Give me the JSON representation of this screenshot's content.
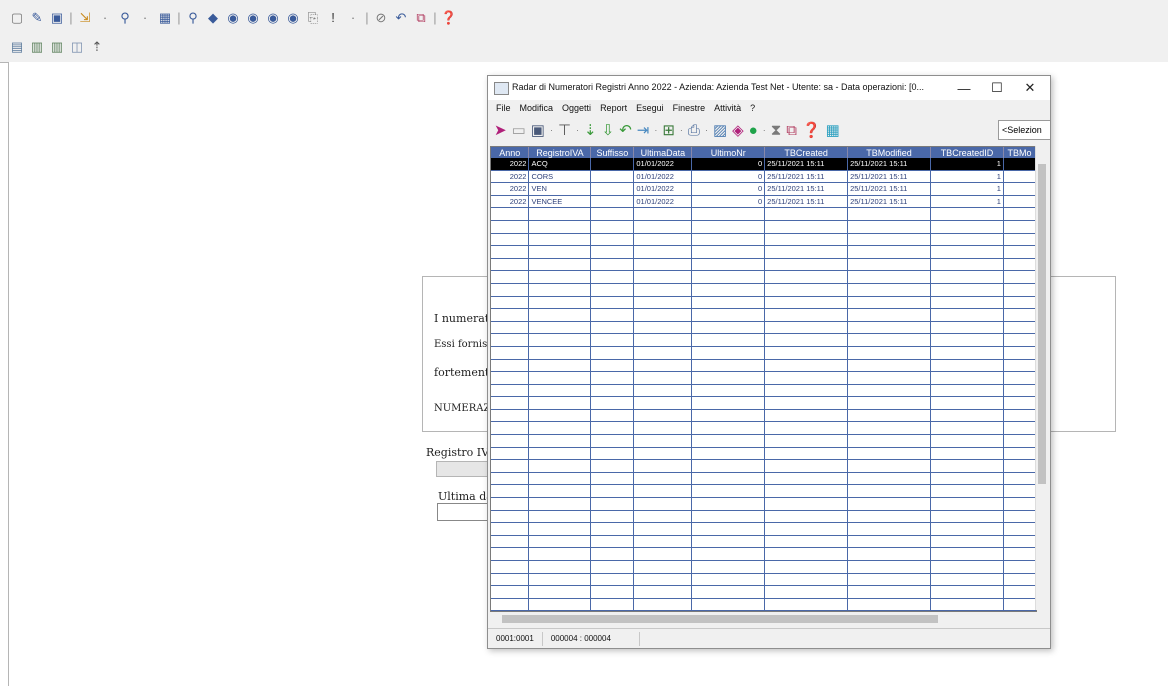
{
  "main_toolbar": {
    "row1_icons": [
      "new-document-icon",
      "edit-document-icon",
      "save-icon",
      "sep",
      "import-icon",
      "dropdown-icon",
      "search-tool-icon",
      "dropdown-icon",
      "settings-report-icon",
      "sep",
      "find-icon",
      "filter-icon",
      "first-record-icon",
      "prev-record-icon",
      "next-record-icon",
      "last-record-icon",
      "copy-icon",
      "exclamation-icon",
      "dropdown-icon",
      "sep",
      "attach-icon",
      "undo-icon",
      "gift-icon",
      "sep",
      "help-icon"
    ],
    "row2_icons": [
      "calendar-icon",
      "bank-icon",
      "bank-icon",
      "note-icon",
      "upload-icon"
    ]
  },
  "background_form": {
    "info_lines": [
      "I numerato",
      "Essi fornisc",
      "fortemente",
      "NUMERAZIO"
    ],
    "registro_label": "Registro IV",
    "ultima_label": "Ultima dat"
  },
  "dialog": {
    "title": "Radar di Numeratori Registri Anno 2022 - Azienda: Azienda Test Net - Utente: sa - Data operazioni: [0...",
    "window_controls": {
      "minimize": "—",
      "maximize": "☐",
      "close": "✕"
    },
    "menu": [
      "File",
      "Modifica",
      "Oggetti",
      "Report",
      "Esegui",
      "Finestre",
      "Attività",
      "?"
    ],
    "selector_text": "<Selezion",
    "grid": {
      "columns": [
        "Anno",
        "RegistroIVA",
        "Suffisso",
        "UltimaData",
        "UltimoNr",
        "TBCreated",
        "TBModified",
        "TBCreatedID",
        "TBMo"
      ],
      "rows": [
        [
          "2022",
          "ACQ",
          "",
          "01/01/2022",
          "0",
          "25/11/2021 15:11",
          "25/11/2021 15:11",
          "1",
          ""
        ],
        [
          "2022",
          "CORS",
          "",
          "01/01/2022",
          "0",
          "25/11/2021 15:11",
          "25/11/2021 15:11",
          "1",
          ""
        ],
        [
          "2022",
          "VEN",
          "",
          "01/01/2022",
          "0",
          "25/11/2021 15:11",
          "25/11/2021 15:11",
          "1",
          ""
        ],
        [
          "2022",
          "VENCEE",
          "",
          "01/01/2022",
          "0",
          "25/11/2021 15:11",
          "25/11/2021 15:11",
          "1",
          ""
        ]
      ]
    },
    "status": {
      "position": "0001:0001",
      "count": "000004 : 000004"
    }
  }
}
